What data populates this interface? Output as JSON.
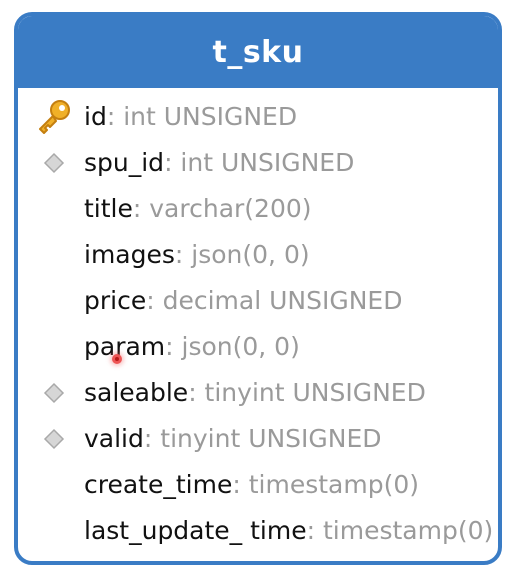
{
  "table": {
    "name": "t_sku",
    "columns": [
      {
        "name": "id",
        "type": ": int UNSIGNED",
        "icon": "key-icon"
      },
      {
        "name": "spu_id",
        "type": ": int UNSIGNED",
        "icon": "index-diamond-icon"
      },
      {
        "name": "title",
        "type": ": varchar(200)",
        "icon": ""
      },
      {
        "name": "images",
        "type": ": json(0, 0)",
        "icon": ""
      },
      {
        "name": "price",
        "type": ": decimal UNSIGNED",
        "icon": ""
      },
      {
        "name": "param",
        "type": ": json(0, 0)",
        "icon": ""
      },
      {
        "name": "saleable",
        "type": ": tinyint UNSIGNED",
        "icon": "index-diamond-icon"
      },
      {
        "name": "valid",
        "type": ": tinyint UNSIGNED",
        "icon": "index-diamond-icon"
      },
      {
        "name": "create_time",
        "type": ": timestamp(0)",
        "icon": ""
      },
      {
        "name": "last_update_ time",
        "type": ": timestamp(0)",
        "icon": ""
      }
    ]
  },
  "colors": {
    "header": "#3a7cc5",
    "title_text": "#ffffff",
    "column_name": "#111111",
    "column_type": "#9a9a9a",
    "key_icon": "#e8a020",
    "diamond_icon": "#cfcfcf",
    "cursor_marker": "#ee5555"
  }
}
